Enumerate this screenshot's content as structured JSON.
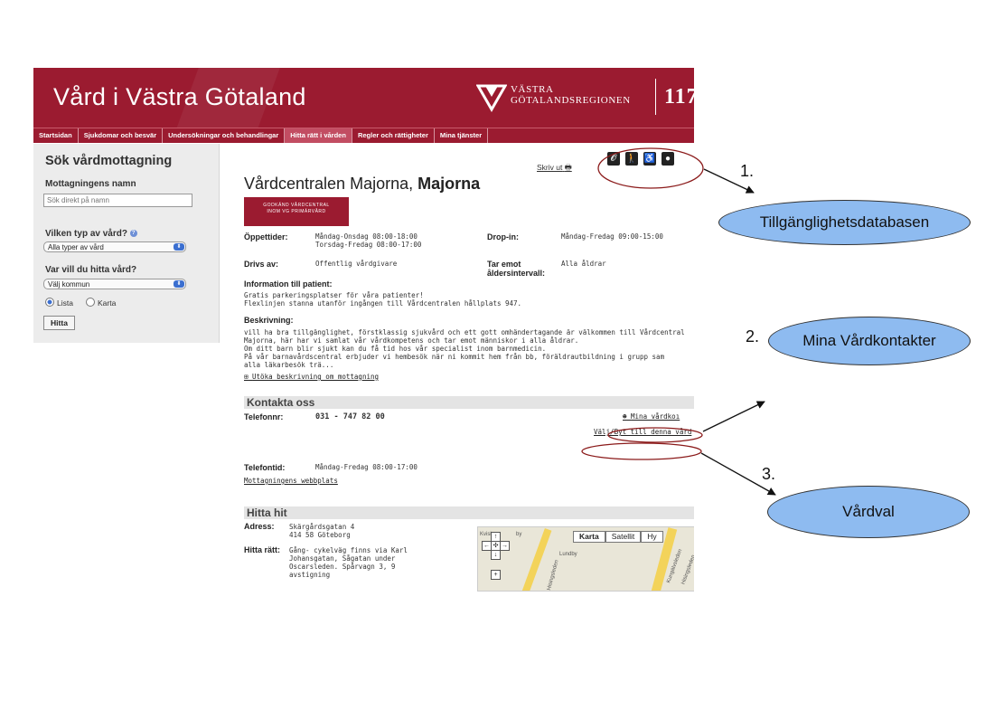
{
  "header": {
    "title": "Vård i Västra Götaland",
    "region_line1": "VÄSTRA",
    "region_line2": "GÖTALANDSREGIONEN",
    "phone": "117"
  },
  "nav": {
    "items": [
      "Startsidan",
      "Sjukdomar och besvär",
      "Undersökningar och behandlingar",
      "Hitta rätt i vården",
      "Regler och rättigheter",
      "Mina tjänster"
    ]
  },
  "sidebar": {
    "heading": "Sök vårdmottagning",
    "name_label": "Mottagningens namn",
    "name_placeholder": "Sök direkt på namn",
    "type_label": "Vilken typ av vård?",
    "type_value": "Alla typer av vård",
    "where_label": "Var vill du hitta vård?",
    "where_value": "Välj kommun",
    "radio_list": "Lista",
    "radio_map": "Karta",
    "button": "Hitta"
  },
  "main": {
    "print": "Skriv ut",
    "title_a": "Vårdcentralen Majorna,",
    "title_b": "Majorna",
    "badge_1": "GODKÄND VÅRDCENTRAL",
    "badge_2": "INOM VG PRIMÄRVÅRD",
    "open_label": "Öppettider:",
    "open_1": "Måndag-Onsdag 08:00-18:00",
    "open_2": "Torsdag-Fredag 08:00-17:00",
    "dropin_label": "Drop-in:",
    "dropin_value": "Måndag-Fredag 09:00-15:00",
    "drivs_label": "Drivs av:",
    "drivs_value": "Offentlig vårdgivare",
    "age_label_1": "Tar emot",
    "age_label_2": "åldersintervall:",
    "age_value": "Alla åldrar",
    "info_label": "Information till patient:",
    "info_1": "Gratis parkeringsplatser för våra patienter!",
    "info_2": "Flexlinjen stanna utanför ingången till Vårdcentralen hållplats 947.",
    "desc_label": "Beskrivning:",
    "desc_1": "vill ha bra tillgänglighet, förstklassig sjukvård och ett gott omhändertagande är välkommen till Vårdcentral",
    "desc_2": "Majorna, här har vi samlat vår vårdkompetens och tar emot människor i alla åldrar.",
    "desc_3": "Om ditt barn blir sjukt kan du få tid hos vår specialist inom barnmedicin.",
    "desc_4": "På vår barnavårdscentral erbjuder vi hembesök när ni kommit hem från bb, föräldrautbildning i grupp sam",
    "desc_5": "alla läkarbesök trä...",
    "expand": "Utöka beskrivning om mottagning",
    "contact_heading": "Kontakta oss",
    "phone_label": "Telefonnr:",
    "phone_value": "031 - 747 82 00",
    "mina": "Mina vårdkoı",
    "valj": "Välj/Byt till denna vård",
    "phonetime_label": "Telefontid:",
    "phonetime_value": "Måndag-Fredag 08:00-17:00",
    "website": "Mottagningens webbplats",
    "find_heading": "Hitta hit",
    "address_label": "Adress:",
    "address_1": "Skärgårdsgatan 4",
    "address_2": "414 58 Göteborg",
    "route_label": "Hitta rätt:",
    "route_1": "Gång- cykelväg finns via Karl",
    "route_2": "Johansgatan, Sågatan under",
    "route_3": "Oscarsleden. Spårvagn 3, 9",
    "route_4": "avstigning"
  },
  "map": {
    "tab_map": "Karta",
    "tab_sat": "Satellit",
    "tab_hy": "Hy",
    "place_1": "Kvisl",
    "place_2": "by",
    "place_3": "Lundby",
    "place_4": "Hisingsleden",
    "place_5": "Kungälvsleden",
    "place_6": "Hisingsleden"
  },
  "annotations": {
    "n1": "1.",
    "b1": "Tillgänglighetsdatabasen",
    "n2": "2.",
    "b2": "Mina Vårdkontakter",
    "n3": "3.",
    "b3": "Vårdval"
  },
  "colors": {
    "brand": "#9b1b30",
    "bubble": "#8ebbf0"
  }
}
